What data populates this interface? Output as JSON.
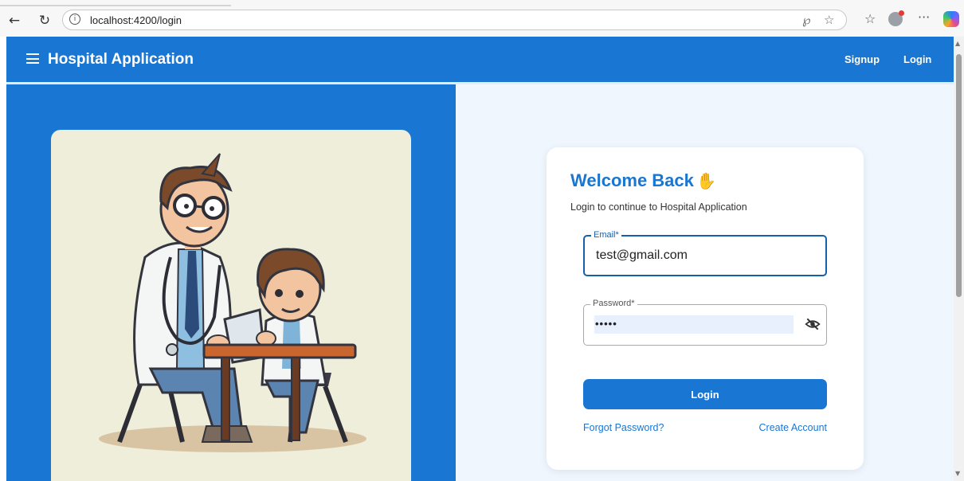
{
  "browser": {
    "url": "localhost:4200/login",
    "icons": [
      "back-arrow-icon",
      "refresh-icon",
      "info-icon",
      "read-aloud-icon",
      "favorite-star-icon",
      "favorites-icon",
      "profile-icon",
      "more-icon",
      "copilot-icon"
    ]
  },
  "toolbar": {
    "title": "Hospital Application",
    "signup_label": "Signup",
    "login_label": "Login",
    "color": "#1976d2"
  },
  "login": {
    "heading": "Welcome Back",
    "wave_icon": "waving-hand-icon",
    "subtitle": "Login to continue to Hospital Application",
    "email_label": "Email*",
    "email_value": "test@gmail.com",
    "password_label": "Password*",
    "password_value": "•••••",
    "toggle_icon": "eye-off-icon",
    "submit_label": "Login",
    "forgot_label": "Forgot Password?",
    "create_label": "Create Account"
  },
  "illustration": {
    "icon": "doctor-and-child-illustration"
  }
}
